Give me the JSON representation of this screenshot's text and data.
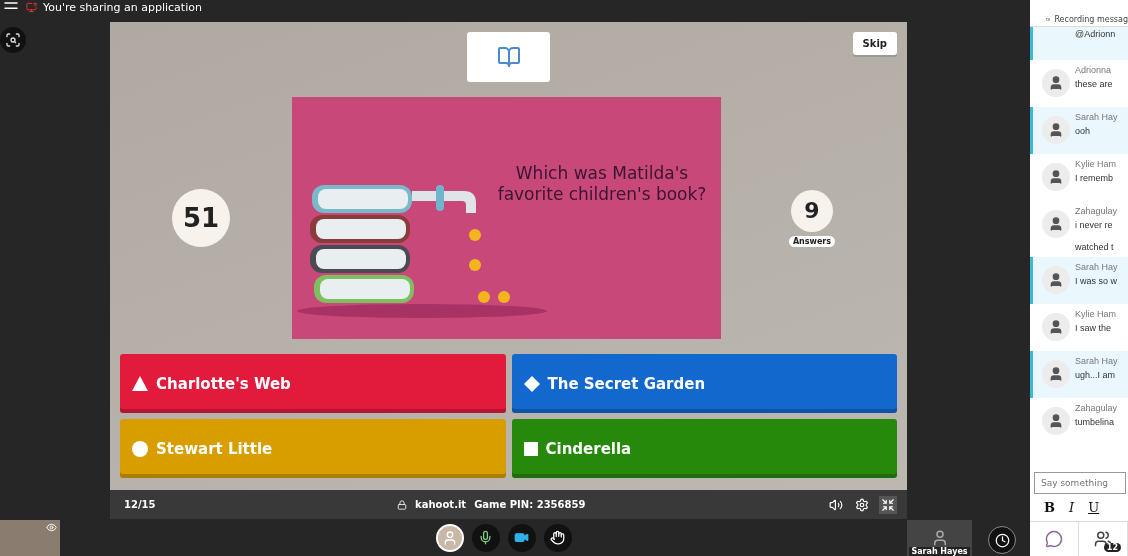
{
  "share_banner": {
    "text": "You're sharing an application"
  },
  "game": {
    "question_image": {
      "question": "Which was Matilda's favorite children's book?"
    },
    "skip_label": "Skip",
    "timer": "51",
    "answers_count": "9",
    "answers_label": "Answers",
    "answers": [
      {
        "kind": "triangle",
        "text": "Charlotte's Web",
        "color": "#e21b3c"
      },
      {
        "kind": "diamond",
        "text": "The Secret Garden",
        "color": "#1368ce"
      },
      {
        "kind": "circle",
        "text": "Stewart Little",
        "color": "#d89e00"
      },
      {
        "kind": "square",
        "text": "Cinderella",
        "color": "#26890c"
      }
    ],
    "footer": {
      "progress": "12/15",
      "site": "kahoot.it",
      "pin": "Game PIN: 2356859"
    }
  },
  "participant_tile": {
    "name": "Sarah Hayes"
  },
  "chat": {
    "recording_note": "Recording messag",
    "messages": [
      {
        "text": "@Adrionn",
        "highlighted": true
      },
      {
        "name": "Adrionna",
        "text": "these are",
        "highlighted": false
      },
      {
        "name": "Sarah Hay",
        "text": "ooh",
        "highlighted": true
      },
      {
        "name": "Kylie Ham",
        "text": "I rememb",
        "highlighted": false
      },
      {
        "name": "Zahagulay",
        "text": "i never re",
        "extra": "watched t",
        "highlighted": false
      },
      {
        "name": "Sarah Hay",
        "text": "I was so w",
        "highlighted": true
      },
      {
        "name": "Kylie Ham",
        "text": "I saw the",
        "highlighted": false
      },
      {
        "name": "Sarah Hay",
        "text": "ugh...I am",
        "highlighted": true
      },
      {
        "name": "Zahagulay",
        "text": "tumbelina",
        "highlighted": false
      }
    ],
    "input": {
      "placeholder": "Say something"
    },
    "format_buttons": [
      "B",
      "I",
      "U"
    ],
    "people_count": "12"
  }
}
